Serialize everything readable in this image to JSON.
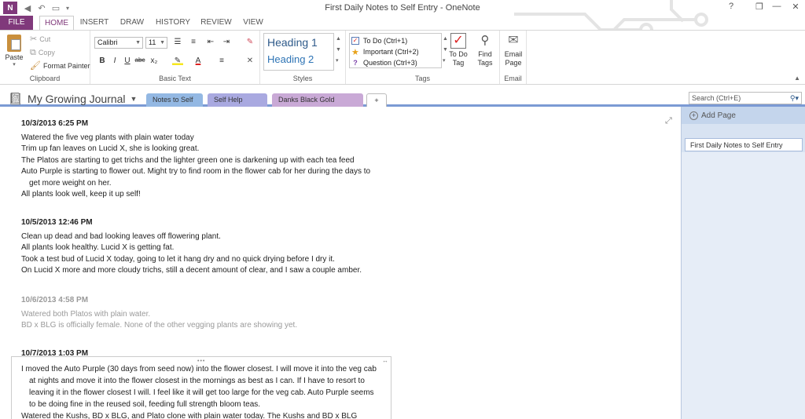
{
  "window": {
    "title": "First Daily Notes to Self Entry - OneNote"
  },
  "titlebar": {
    "help": "?",
    "restore": "❐",
    "minimize": "—",
    "maximize": "□",
    "close": "✕"
  },
  "tabs": [
    "FILE",
    "HOME",
    "INSERT",
    "DRAW",
    "HISTORY",
    "REVIEW",
    "VIEW"
  ],
  "clipboard": {
    "paste": "Paste",
    "cut": "Cut",
    "copy": "Copy",
    "format_painter": "Format Painter",
    "group": "Clipboard"
  },
  "basic_text": {
    "font": "Calibri",
    "size": "11",
    "group": "Basic Text"
  },
  "styles": {
    "heading1": "Heading 1",
    "heading2": "Heading 2",
    "group": "Styles"
  },
  "tags": {
    "items": [
      "To Do (Ctrl+1)",
      "Important (Ctrl+2)",
      "Question (Ctrl+3)"
    ],
    "todo_tag": "To Do Tag",
    "find_tags": "Find Tags",
    "group": "Tags"
  },
  "email": {
    "button": "Email Page",
    "group": "Email"
  },
  "notebook": {
    "name": "My Growing Journal"
  },
  "sections": [
    {
      "label": "Notes to Self",
      "color": "#93b8e3"
    },
    {
      "label": "Self Help Guide",
      "color": "#a9a9e0"
    },
    {
      "label": "Danks Black Gold Recipe",
      "color": "#c9a9d6"
    }
  ],
  "search": {
    "placeholder": "Search (Ctrl+E)"
  },
  "pages_panel": {
    "add_page": "Add Page",
    "pages": [
      "First Daily Notes to Self Entry"
    ]
  },
  "entries": [
    {
      "date": "10/3/2013 6:25 PM",
      "lines": [
        "Watered the five veg plants with plain water today",
        "Trim up fan leaves on Lucid X, she is looking great.",
        "The Platos are starting to get trichs and the lighter green one is darkening up with each tea feed",
        "Auto Purple is starting to flower out.  Might try to find room in the flower cab for her during the days to",
        "get more weight on her.",
        "All plants look well, keep it up self!"
      ]
    },
    {
      "date": "10/5/2013 12:46 PM",
      "lines": [
        "Clean up dead and bad looking leaves off flowering plant.",
        "All plants look healthy.  Lucid X is getting fat.",
        "Took a test bud of Lucid X today, going to let it hang dry and no quick drying before I dry it.",
        "On Lucid X more and more cloudy trichs, still a decent amount of clear, and I saw a couple amber."
      ]
    },
    {
      "date": "10/6/2013 4:58 PM",
      "lines": [
        "Watered both Platos with plain water.",
        "BD x BLG is officially female.  None of the other vegging plants are showing yet."
      ]
    },
    {
      "date": "10/7/2013 1:03 PM",
      "lines": [
        "I moved the Auto Purple (30 days from seed now) into the flower closest.  I will move it into the veg cab",
        "at nights and move it into the flower closest in the mornings as best as I can.  If I have to resort to",
        "leaving it in the flower closest I will.  I feel like it will get too large for the veg cab.  Auto Purple seems",
        "to be doing fine in the reused soil, feeding full strength bloom teas.",
        "Watered the Kushs, BD x BLG, and Plato clone with plain water today.  The Kushs and BD x BLG"
      ]
    }
  ]
}
